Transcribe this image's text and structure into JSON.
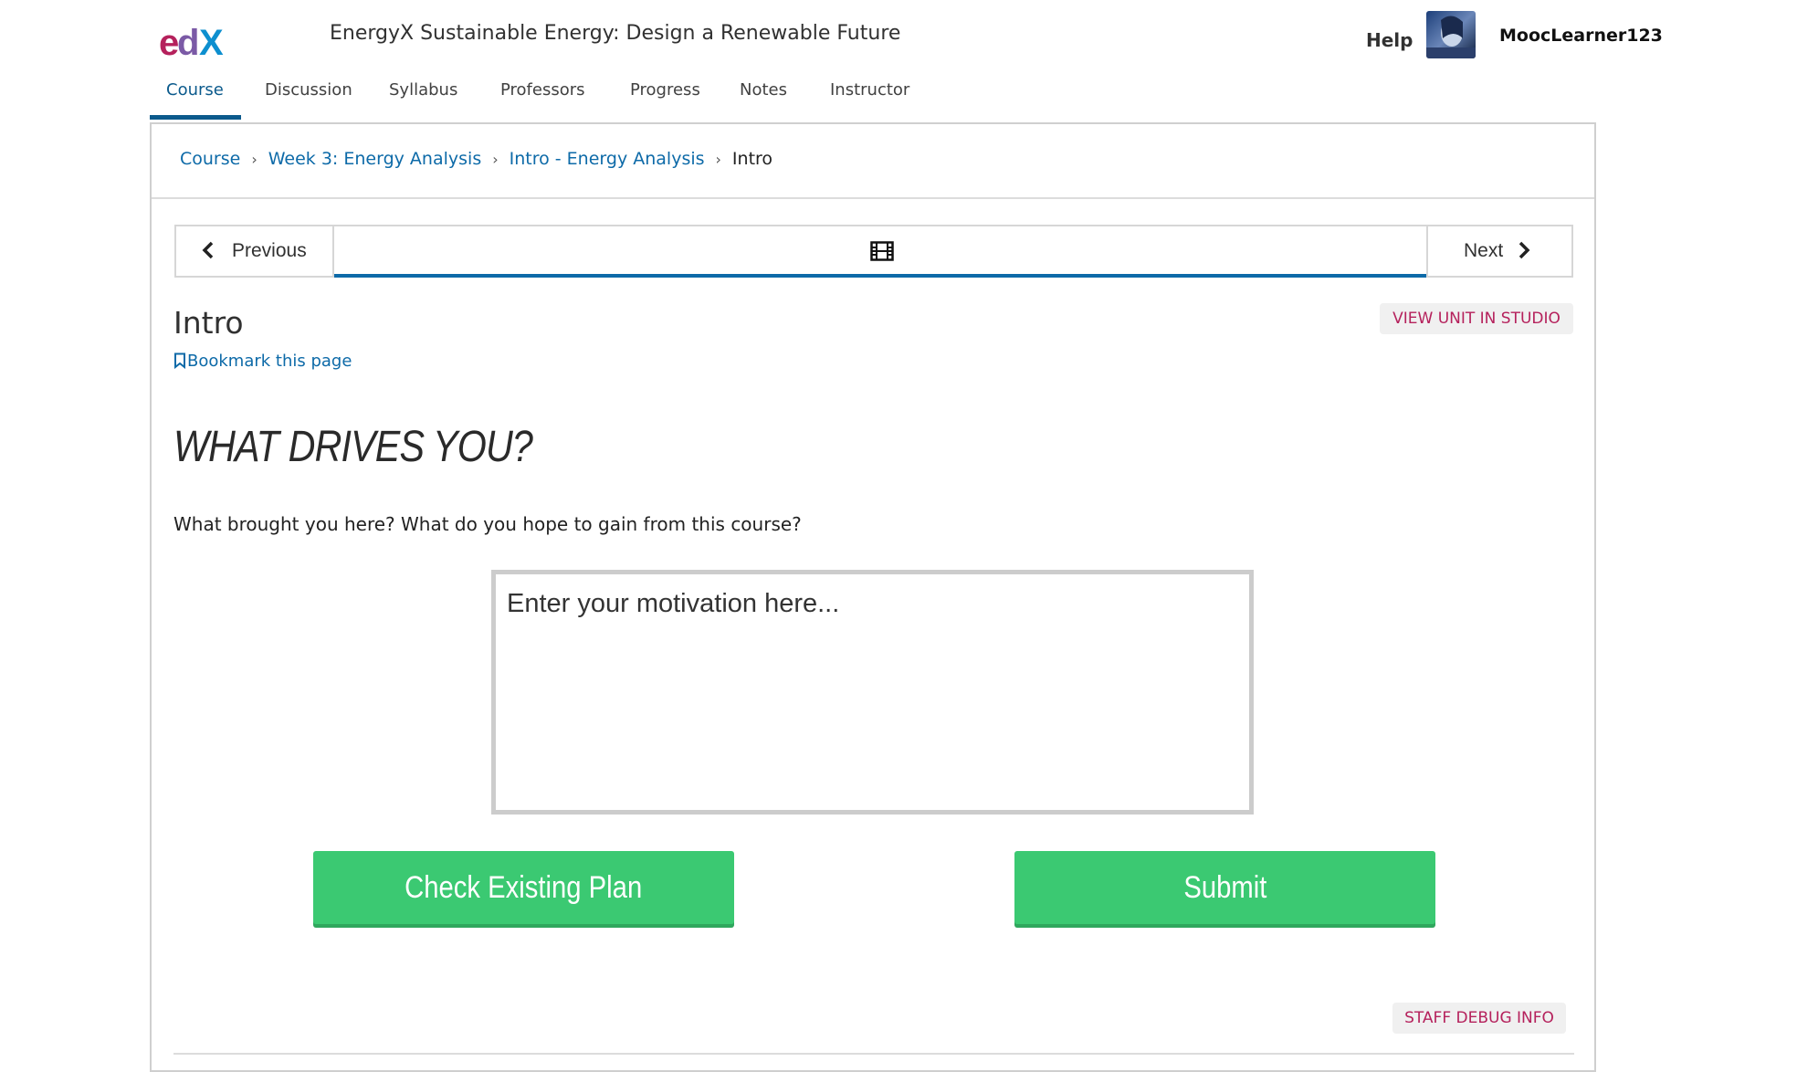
{
  "header": {
    "logo": "edX",
    "course_title": "EnergyX Sustainable Energy: Design a Renewable Future",
    "help_label": "Help",
    "username": "MoocLearner123"
  },
  "nav": {
    "tabs": [
      "Course",
      "Discussion",
      "Syllabus",
      "Professors",
      "Progress",
      "Notes",
      "Instructor"
    ],
    "active_tab": "Course"
  },
  "breadcrumbs": {
    "items": [
      "Course",
      "Week 3: Energy Analysis",
      "Intro - Energy Analysis"
    ],
    "current": "Intro"
  },
  "sequence_nav": {
    "previous_label": "Previous",
    "next_label": "Next",
    "unit_icon": "film-icon"
  },
  "unit": {
    "title": "Intro",
    "bookmark_label": "Bookmark this page",
    "studio_label": "VIEW UNIT IN STUDIO"
  },
  "content": {
    "headline": "WHAT DRIVES YOU?",
    "question": "What brought you here? What do you hope to gain from this course?",
    "motivation_placeholder": "Enter your motivation here...",
    "check_button": "Check Existing Plan",
    "submit_button": "Submit",
    "debug_label": "STAFF DEBUG INFO"
  },
  "colors": {
    "link_blue": "#0d6aa8",
    "accent_magenta": "#b5215c",
    "button_green": "#3bc972"
  }
}
